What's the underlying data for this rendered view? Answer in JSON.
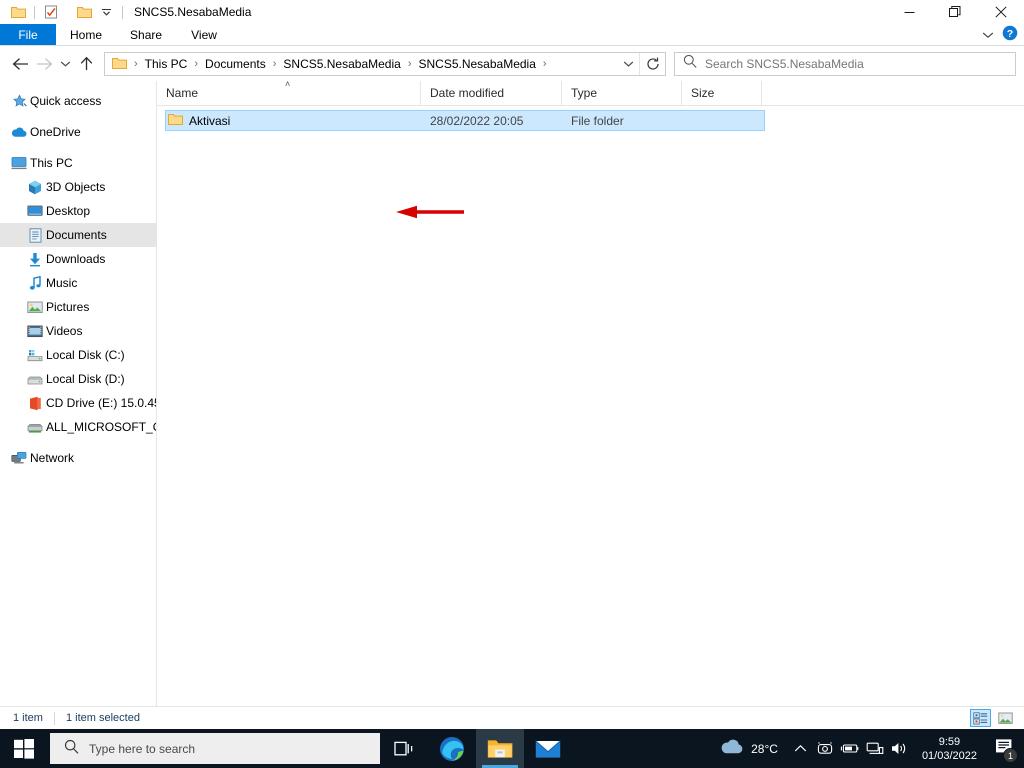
{
  "window": {
    "title": "SNCS5.NesabaMedia",
    "quick_access": [
      {
        "name": "folder-icon",
        "label": "Folder"
      },
      {
        "name": "properties-icon",
        "label": "Properties"
      },
      {
        "name": "new-folder-icon",
        "label": "New folder"
      },
      {
        "name": "chevron-down-icon",
        "label": "Customize Quick Access Toolbar"
      }
    ],
    "controls": {
      "minimize": "—",
      "maximize": "❐",
      "close": "✕"
    }
  },
  "ribbon": {
    "tabs": [
      {
        "label": "File",
        "active": true
      },
      {
        "label": "Home",
        "active": false
      },
      {
        "label": "Share",
        "active": false
      },
      {
        "label": "View",
        "active": false
      }
    ],
    "collapse_label": "⌄",
    "help_label": "?"
  },
  "address": {
    "back_label": "←",
    "forward_label": "→",
    "recent_label": "⌄",
    "up_label": "↑",
    "breadcrumb": [
      "This PC",
      "Documents",
      "SNCS5.NesabaMedia",
      "SNCS5.NesabaMedia"
    ],
    "separator": "›",
    "dropdown_label": "⌄",
    "refresh_label": "↻"
  },
  "search": {
    "placeholder": "Search SNCS5.NesabaMedia",
    "icon": "search-icon"
  },
  "sidebar": {
    "items": [
      {
        "label": "Quick access",
        "icon": "star-icon",
        "level": 0,
        "selected": false,
        "gap_before": false
      },
      {
        "label": "OneDrive",
        "icon": "cloud-icon",
        "level": 0,
        "selected": false,
        "gap_before": true
      },
      {
        "label": "This PC",
        "icon": "monitor-icon",
        "level": 0,
        "selected": false,
        "gap_before": true
      },
      {
        "label": "3D Objects",
        "icon": "cube-icon",
        "level": 1,
        "selected": false,
        "gap_before": false
      },
      {
        "label": "Desktop",
        "icon": "desktop-icon",
        "level": 1,
        "selected": false,
        "gap_before": false
      },
      {
        "label": "Documents",
        "icon": "documents-icon",
        "level": 1,
        "selected": true,
        "gap_before": false
      },
      {
        "label": "Downloads",
        "icon": "download-icon",
        "level": 1,
        "selected": false,
        "gap_before": false
      },
      {
        "label": "Music",
        "icon": "music-note-icon",
        "level": 1,
        "selected": false,
        "gap_before": false
      },
      {
        "label": "Pictures",
        "icon": "pictures-icon",
        "level": 1,
        "selected": false,
        "gap_before": false
      },
      {
        "label": "Videos",
        "icon": "videos-icon",
        "level": 1,
        "selected": false,
        "gap_before": false
      },
      {
        "label": "Local Disk (C:)",
        "icon": "system-drive-icon",
        "level": 1,
        "selected": false,
        "gap_before": false
      },
      {
        "label": "Local Disk (D:)",
        "icon": "drive-icon",
        "level": 1,
        "selected": false,
        "gap_before": false
      },
      {
        "label": "CD Drive (E:) 15.0.45",
        "icon": "office-disc-icon",
        "level": 1,
        "selected": false,
        "gap_before": false
      },
      {
        "label": "ALL_MICROSOFT_O",
        "icon": "network-drive-icon",
        "level": 1,
        "selected": false,
        "gap_before": false
      },
      {
        "label": "Network",
        "icon": "network-icon",
        "level": 0,
        "selected": false,
        "gap_before": true
      }
    ]
  },
  "filelist": {
    "columns": [
      {
        "label": "Name",
        "key": "name",
        "sorted": true,
        "sort_caret": "˄"
      },
      {
        "label": "Date modified",
        "key": "date",
        "sorted": false
      },
      {
        "label": "Type",
        "key": "type",
        "sorted": false
      },
      {
        "label": "Size",
        "key": "size",
        "sorted": false
      }
    ],
    "rows": [
      {
        "name": "Aktivasi",
        "date": "28/02/2022 20:05",
        "type": "File folder",
        "size": "",
        "icon": "folder-icon",
        "selected": true
      }
    ],
    "annotation": {
      "type": "arrow",
      "direction": "left",
      "color": "#d90000"
    }
  },
  "statusbar": {
    "item_count": "1 item",
    "selection": "1 item selected",
    "views": [
      {
        "name": "details-view-button",
        "active": true
      },
      {
        "name": "large-icons-view-button",
        "active": false
      }
    ]
  },
  "taskbar": {
    "start_label": "Start",
    "search_placeholder": "Type here to search",
    "apps": [
      {
        "name": "task-view-icon",
        "label": "Task View",
        "active": false
      },
      {
        "name": "edge-icon",
        "label": "Microsoft Edge",
        "active": false
      },
      {
        "name": "file-explorer-icon",
        "label": "File Explorer",
        "active": true
      },
      {
        "name": "mail-icon",
        "label": "Mail",
        "active": false
      }
    ],
    "tray": {
      "temperature": "28°C",
      "weather_icon": "cloud-icon",
      "chevron": "⌃",
      "icons": [
        "camera-icon",
        "battery-icon",
        "network-icon",
        "volume-icon"
      ],
      "time": "9:59",
      "date": "01/03/2022",
      "notification_count": "1"
    }
  },
  "colors": {
    "accent": "#0078d7",
    "selection": "#cce8ff",
    "annotation_red": "#d90000",
    "taskbar": "#0a1520"
  }
}
